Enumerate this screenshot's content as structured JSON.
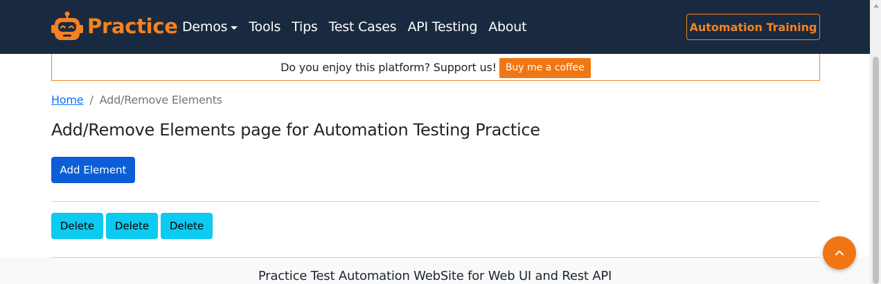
{
  "navbar": {
    "brand": "Practice",
    "links": [
      {
        "label": "Demos",
        "dropdown": true
      },
      {
        "label": "Tools"
      },
      {
        "label": "Tips"
      },
      {
        "label": "Test Cases"
      },
      {
        "label": "API Testing"
      },
      {
        "label": "About"
      }
    ],
    "training_button": "Automation Training",
    "background_color": "#192a40",
    "accent_color": "#f58220"
  },
  "support": {
    "text": "Do you enjoy this platform? Support us!",
    "coffee_button": "Buy me a coffee"
  },
  "breadcrumb": {
    "home": "Home",
    "separator": "/",
    "current": "Add/Remove Elements"
  },
  "page": {
    "title": "Add/Remove Elements page for Automation Testing Practice",
    "add_button": "Add Element",
    "delete_buttons": [
      "Delete",
      "Delete",
      "Delete"
    ]
  },
  "footer": {
    "text": "Practice Test Automation WebSite for Web UI and Rest API"
  },
  "icons": {
    "logo": "robot-logo-icon",
    "scroll_top": "chevron-up-icon"
  }
}
